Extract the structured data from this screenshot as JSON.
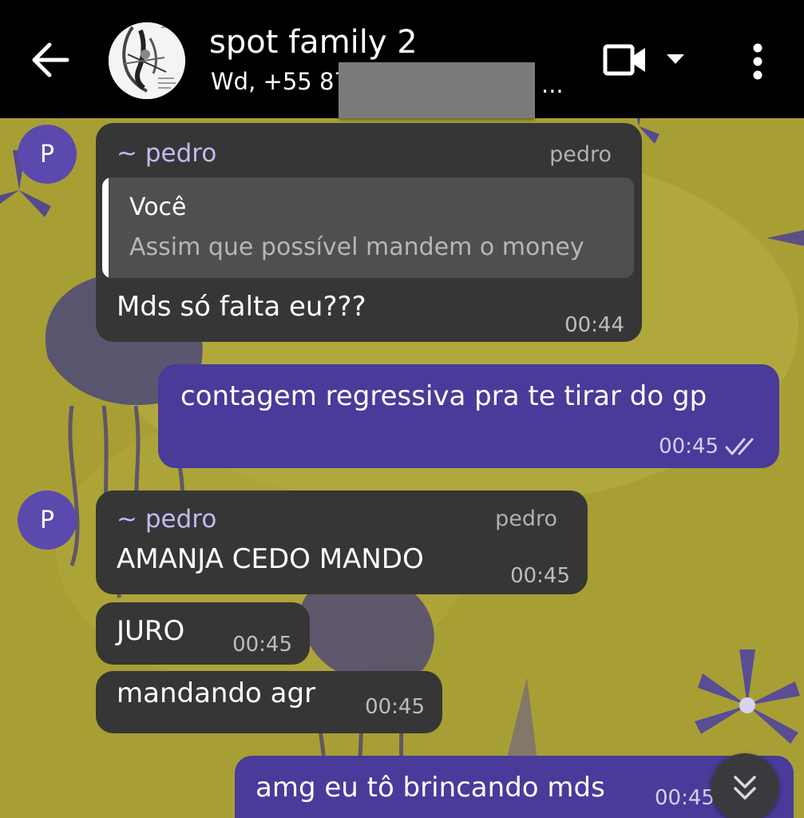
{
  "header": {
    "title": "spot family 2",
    "subtitle": "Wd, +55 87",
    "ellipsis": "...",
    "colors": {
      "background": "#000000",
      "text": "#ffffff",
      "redaction": "#7a7a7a"
    }
  },
  "chat": {
    "colors": {
      "wallpaper": "#a79f34",
      "incoming_bubble": "#363636",
      "outgoing_bubble": "#4a3a9a",
      "avatar": "#5b49ad",
      "sender_name": "#c5b8f3"
    },
    "messages": [
      {
        "direction": "incoming",
        "avatar_letter": "P",
        "sender": "~ pedro",
        "sender_tag": "pedro",
        "quote": {
          "author": "Você",
          "text": "Assim que possível mandem o money"
        },
        "text": "Mds só falta eu???",
        "time": "00:44"
      },
      {
        "direction": "outgoing",
        "text": "contagem regressiva pra te tirar do gp",
        "time": "00:45",
        "status_icon": "double-check-icon"
      },
      {
        "direction": "incoming",
        "avatar_letter": "P",
        "sender": "~ pedro",
        "sender_tag": "pedro",
        "text": "AMANJA CEDO MANDO",
        "time": "00:45"
      },
      {
        "direction": "incoming",
        "text": "JURO",
        "time": "00:45"
      },
      {
        "direction": "incoming",
        "text": "mandando agr",
        "time": "00:45"
      },
      {
        "direction": "outgoing",
        "text": "amg eu tô brincando mds",
        "time": "00:45"
      }
    ],
    "scroll_button_icon": "double-chevron-down-icon"
  }
}
